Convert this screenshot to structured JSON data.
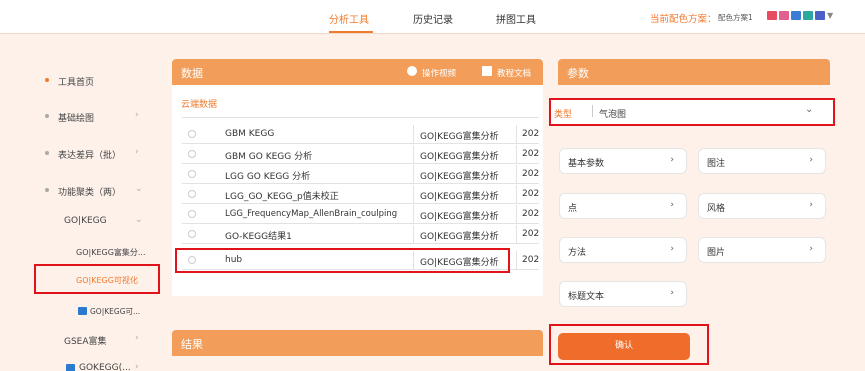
{
  "top_nav": {
    "tabs": [
      "分析工具",
      "历史记录",
      "拼图工具"
    ],
    "active_tab": "分析工具",
    "scheme_label": "当前配色方案：",
    "scheme_value": "配色方案1",
    "swatch_colors": [
      "#e84a5f",
      "#e06090",
      "#3a7bd5",
      "#2ba8a0",
      "#4a60c8"
    ]
  },
  "sidebar": {
    "items": [
      {
        "label": "工具首页",
        "chevron": ""
      },
      {
        "label": "基础绘图",
        "chevron": "›"
      },
      {
        "label": "表达差异（批）",
        "chevron": "›"
      },
      {
        "label": "功能聚类（两）",
        "chevron": "⌄"
      },
      {
        "label": "GO|KEGG",
        "chevron": "⌄"
      },
      {
        "label": "GO|KEGG富集分...",
        "chevron": ""
      },
      {
        "label": "GO|KEGG可视化",
        "chevron": ""
      },
      {
        "label": "GO|KEGG可...",
        "chevron": ""
      },
      {
        "label": "GSEA富集",
        "chevron": "›"
      },
      {
        "label": "GOKEGG(...",
        "chevron": "›"
      }
    ]
  },
  "data_panel": {
    "title": "数据",
    "video_link": "操作视频",
    "doc_link": "教程文档",
    "section_label": "云端数据",
    "rows": [
      {
        "name": "GBM KEGG",
        "type": "GO|KEGG富集分析",
        "date": "202"
      },
      {
        "name": "GBM GO KEGG 分析",
        "type": "GO|KEGG富集分析",
        "date": "202"
      },
      {
        "name": "LGG GO KEGG 分析",
        "type": "GO|KEGG富集分析",
        "date": "202"
      },
      {
        "name": "LGG_GO_KEGG_p值未校正",
        "type": "GO|KEGG富集分析",
        "date": "202"
      },
      {
        "name": "LGG_FrequencyMap_AllenBrain_coulping",
        "type": "GO|KEGG富集分析",
        "date": "202"
      },
      {
        "name": "GO-KEGG结果1",
        "type": "GO|KEGG富集分析",
        "date": "202"
      },
      {
        "name": "hub",
        "type": "GO|KEGG富集分析",
        "date": "202"
      }
    ]
  },
  "result_panel": {
    "title": "结果"
  },
  "params_panel": {
    "title": "参数",
    "type_label": "类型",
    "type_value": "气泡图",
    "buttons": [
      "基本参数",
      "图注",
      "点",
      "风格",
      "方法",
      "图片",
      "标题文本"
    ],
    "confirm_label": "确认"
  }
}
